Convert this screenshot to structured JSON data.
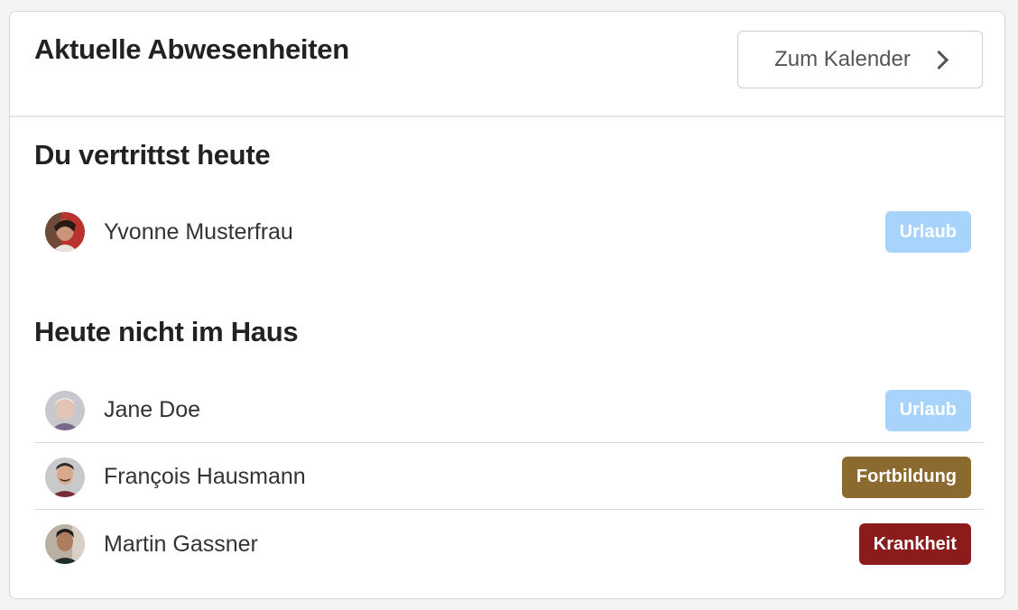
{
  "card": {
    "title": "Aktuelle Abwesenheiten",
    "calendar_button_label": "Zum Kalender"
  },
  "sections": [
    {
      "title": "Du vertrittst heute",
      "people": [
        {
          "name": "Yvonne Musterfrau",
          "status": "Urlaub",
          "status_color": "#a8d4fb"
        }
      ]
    },
    {
      "title": "Heute nicht im Haus",
      "people": [
        {
          "name": "Jane Doe",
          "status": "Urlaub",
          "status_color": "#a8d4fb"
        },
        {
          "name": "François Hausmann",
          "status": "Fortbildung",
          "status_color": "#8b6a2f"
        },
        {
          "name": "Martin Gassner",
          "status": "Krankheit",
          "status_color": "#8c1c1c"
        }
      ]
    }
  ]
}
